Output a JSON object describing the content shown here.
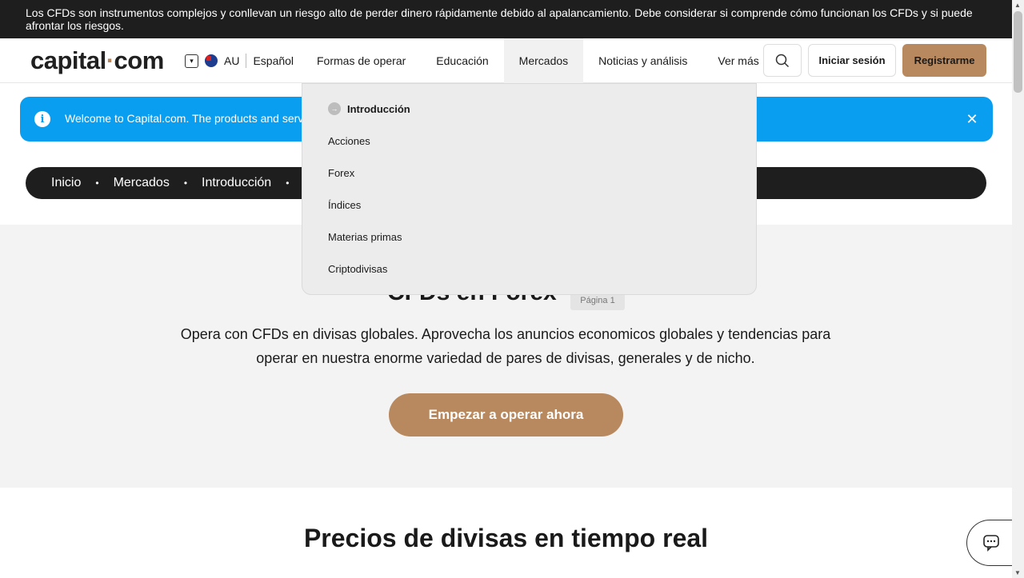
{
  "risk_warning": "Los CFDs son instrumentos complejos y conllevan un riesgo alto de perder dinero rápidamente debido al apalancamiento. Debe considerar si comprende cómo funcionan los CFDs y si puede afrontar los riesgos.",
  "header": {
    "logo_left": "capital",
    "logo_dot": "·",
    "logo_right": "com",
    "region_code": "AU",
    "language": "Español",
    "nav": [
      {
        "label": "Formas de operar"
      },
      {
        "label": "Educación"
      },
      {
        "label": "Mercados"
      },
      {
        "label": "Noticias y análisis"
      },
      {
        "label": "Ver más"
      }
    ],
    "login_label": "Iniciar sesión",
    "signup_label": "Registrarme"
  },
  "welcome": {
    "message": "Welcome to Capital.com. The products and services"
  },
  "breadcrumb": [
    "Inicio",
    "Mercados",
    "Introducción"
  ],
  "hero": {
    "title": "CFDs en Forex",
    "page_badge": "Página 1",
    "description": "Opera con CFDs en divisas globales. Aprovecha los anuncios economicos globales y tendencias para operar en nuestra enorme variedad de pares de divisas, generales y de nicho.",
    "cta_label": "Empezar a operar ahora"
  },
  "section_title": "Precios de divisas en tiempo real",
  "dropdown": {
    "items": [
      "Introducción",
      "Acciones",
      "Forex",
      "Índices",
      "Materias primas",
      "Criptodivisas"
    ]
  },
  "colors": {
    "accent": "#b8895e",
    "banner": "#0a9ef0",
    "dark": "#1e1e1e"
  }
}
